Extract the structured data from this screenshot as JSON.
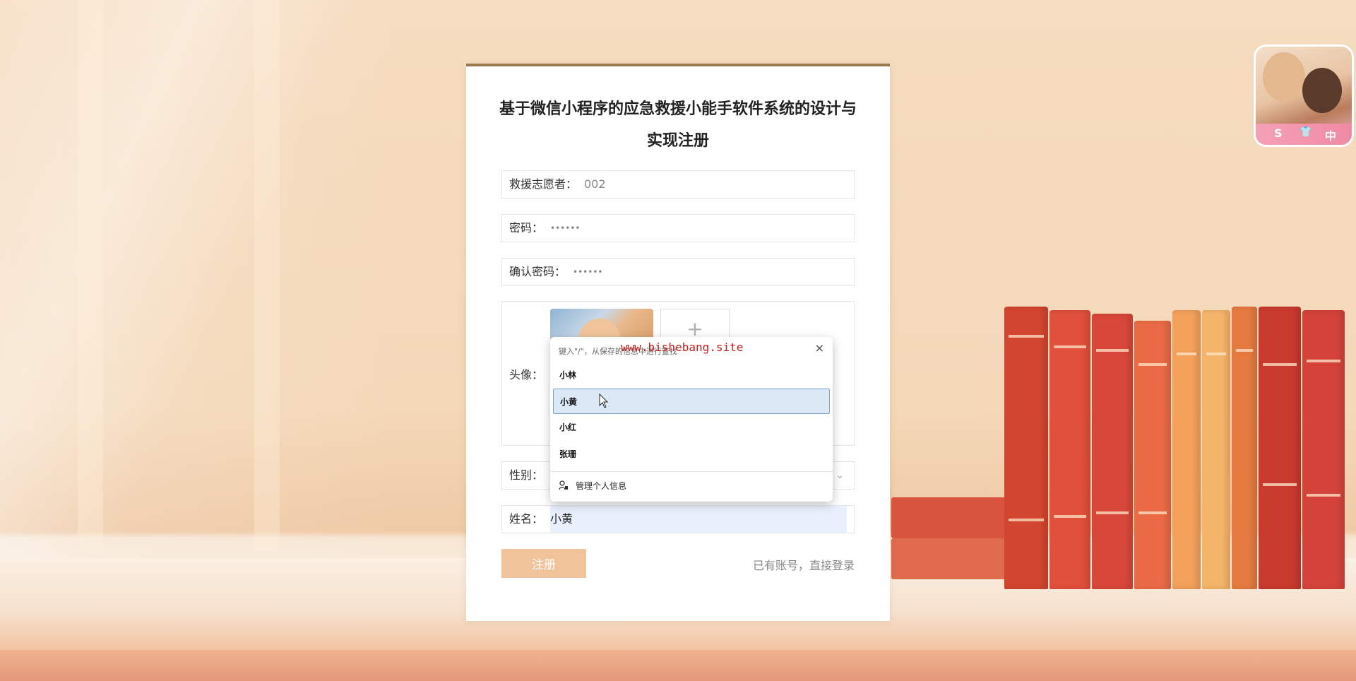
{
  "form": {
    "title": "基于微信小程序的应急救援小能手软件系统的设计与实现注册",
    "fields": {
      "username": {
        "label": "救援志愿者：",
        "value": "002"
      },
      "password": {
        "label": "密码：",
        "value": "••••••"
      },
      "confirm_password": {
        "label": "确认密码：",
        "value": "••••••"
      },
      "avatar": {
        "label": "头像：",
        "upload_icon": "plus-icon"
      },
      "gender": {
        "label": "性别：",
        "icon": "chevron-down-icon"
      },
      "name": {
        "label": "姓名：",
        "value": "小黄"
      }
    },
    "register_button": "注册",
    "login_link": "已有账号，直接登录"
  },
  "autofill": {
    "hint": "键入\"/\"，从保存的信息中进行查找",
    "watermark": "www.bishebang.site",
    "close": "×",
    "items": [
      "小林",
      "小黄",
      "小红",
      "张珊"
    ],
    "selected": "小黄",
    "manage_label": "管理个人信息"
  },
  "corner_badge": {
    "icons": [
      "S",
      "👕",
      "中"
    ]
  },
  "colors": {
    "accent": "#f1c39b",
    "card_border": "#9a7a4f",
    "selection": "#dbe8f6"
  }
}
